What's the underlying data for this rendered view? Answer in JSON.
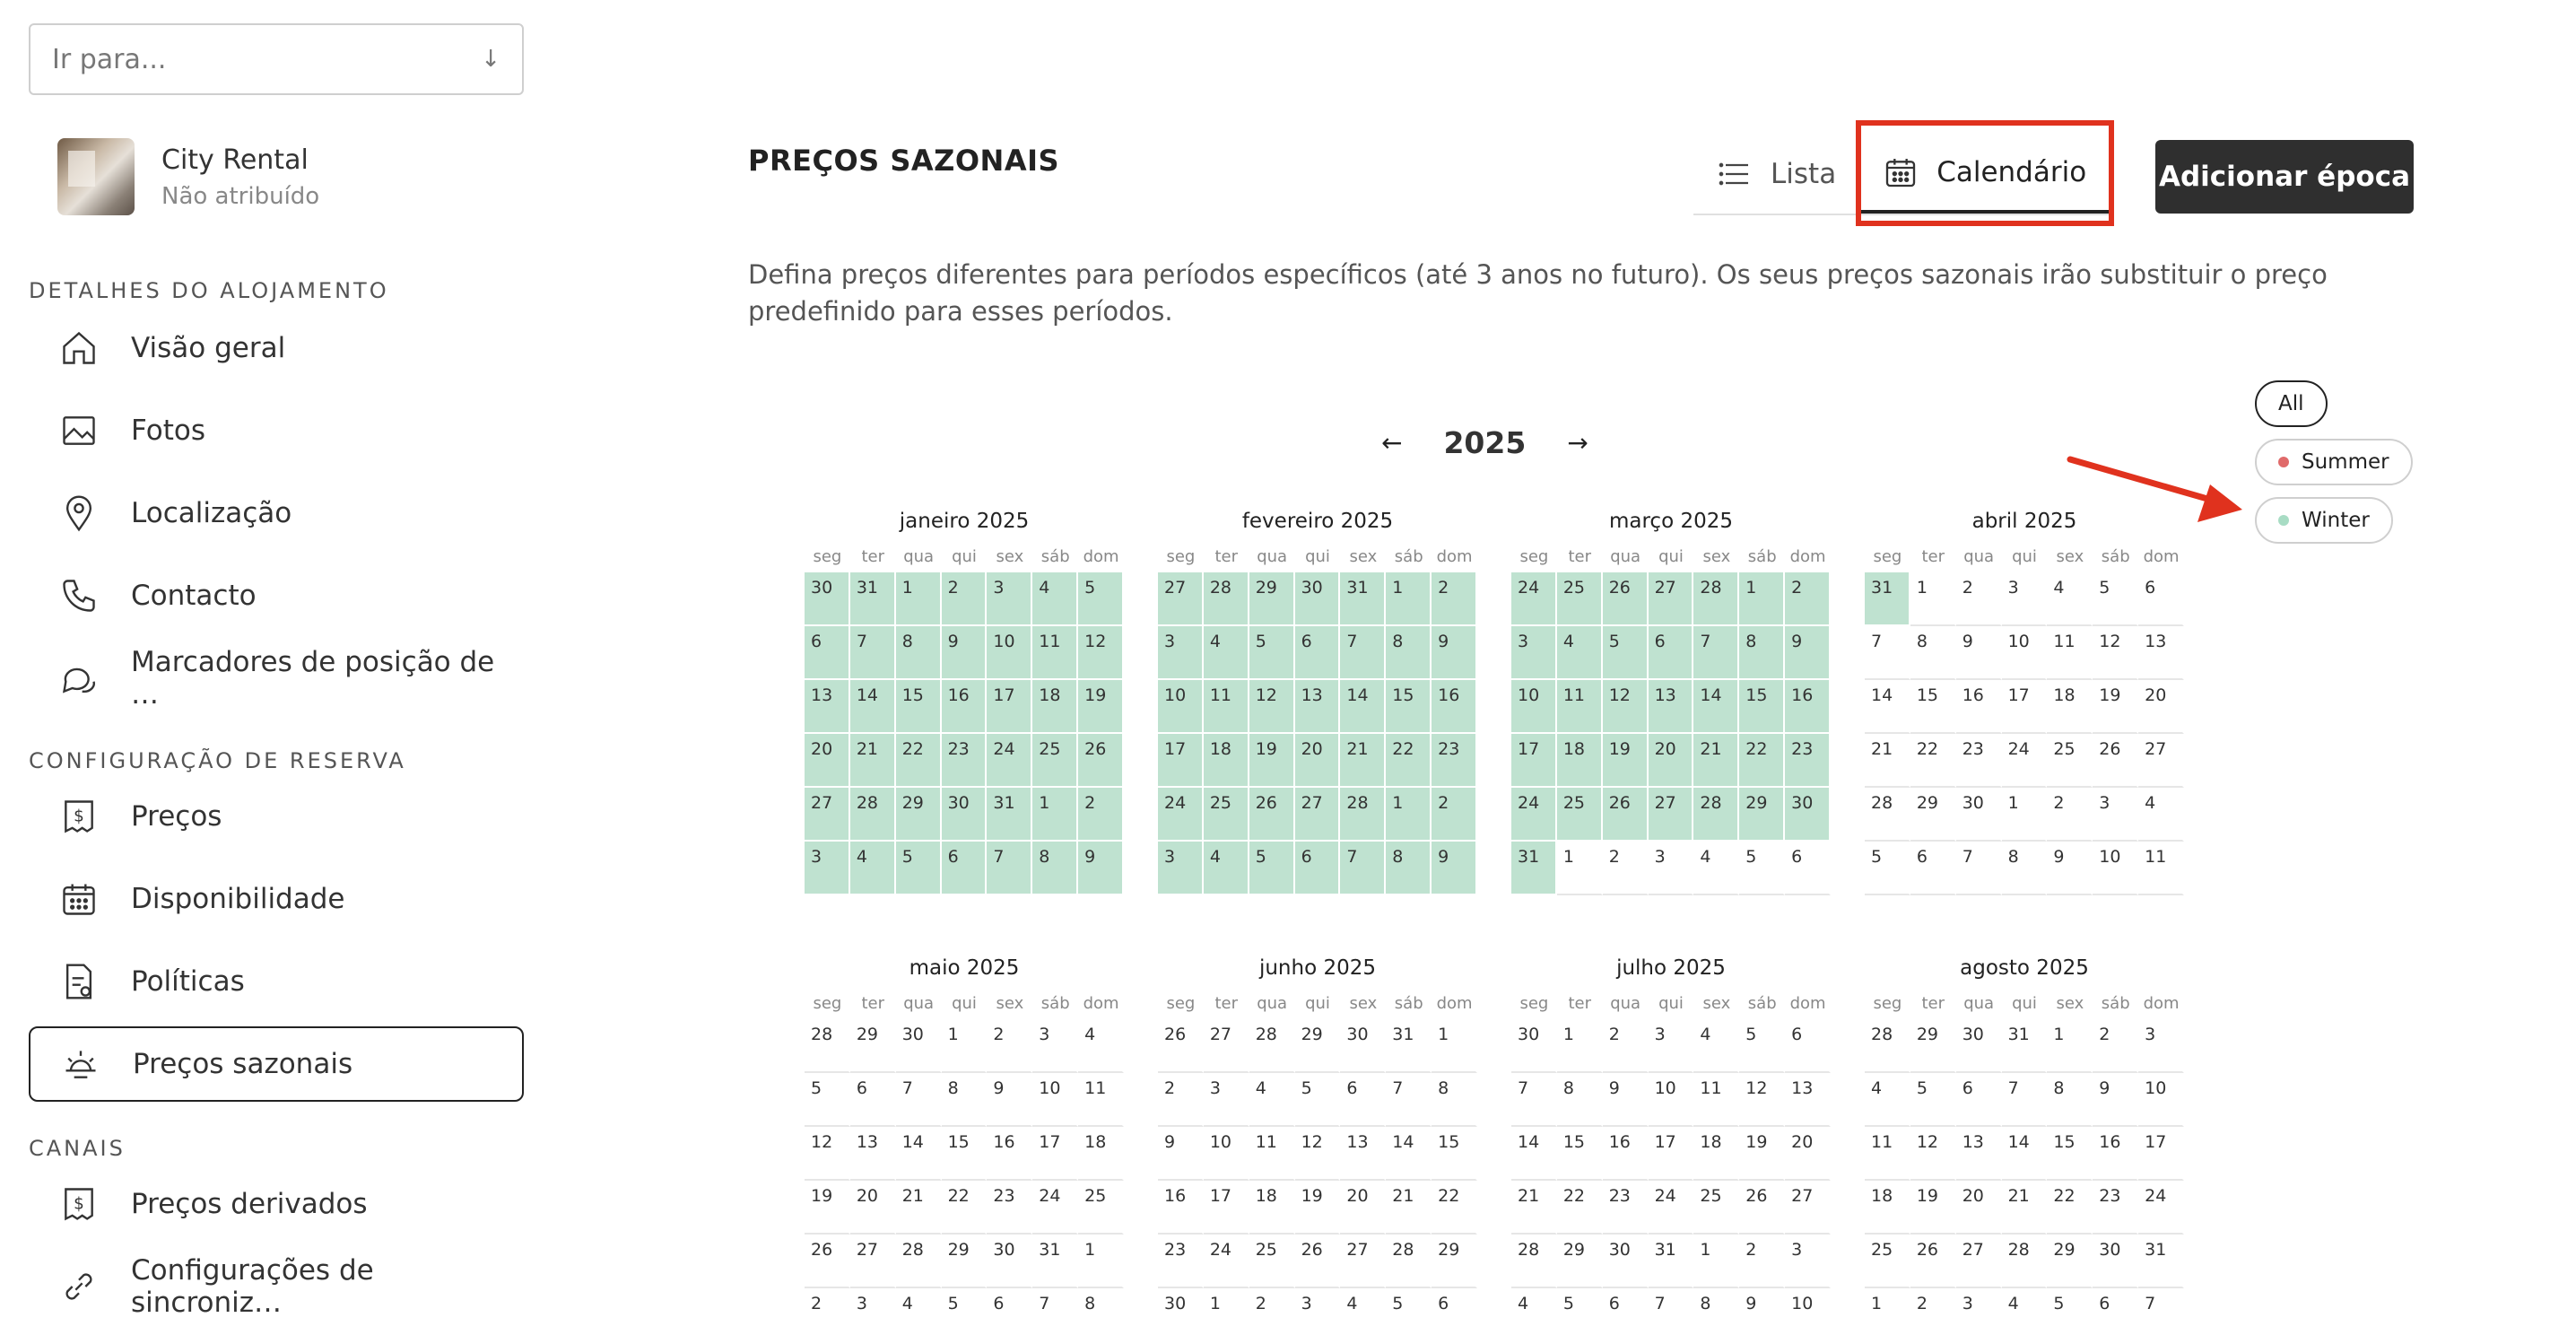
{
  "sidebar": {
    "goto_placeholder": "Ir para...",
    "listing": {
      "name": "City Rental",
      "status": "Não atribuído"
    },
    "sections": [
      {
        "title": "DETALHES DO ALOJAMENTO"
      },
      {
        "title": "CONFIGURAÇÃO DE RESERVA"
      },
      {
        "title": "CANAIS"
      }
    ],
    "items": [
      {
        "label": "Visão geral",
        "icon": "home-icon"
      },
      {
        "label": "Fotos",
        "icon": "image-icon"
      },
      {
        "label": "Localização",
        "icon": "map-pin-icon"
      },
      {
        "label": "Contacto",
        "icon": "phone-icon"
      },
      {
        "label": "Marcadores de posição de …",
        "icon": "chat-bubbles-icon"
      },
      {
        "label": "Preços",
        "icon": "price-tag-icon"
      },
      {
        "label": "Disponibilidade",
        "icon": "calendar-icon"
      },
      {
        "label": "Políticas",
        "icon": "policy-document-icon"
      },
      {
        "label": "Preços sazonais",
        "icon": "sun-icon",
        "active": true
      },
      {
        "label": "Preços derivados",
        "icon": "price-tag-icon"
      },
      {
        "label": "Configurações de sincroniz…",
        "icon": "link-icon"
      }
    ]
  },
  "main": {
    "title": "PREÇOS SAZONAIS",
    "view_tabs": [
      {
        "label": "Lista",
        "icon": "list-icon",
        "active": false
      },
      {
        "label": "Calendário",
        "icon": "calendar-icon",
        "active": true
      }
    ],
    "add_button": "Adicionar época",
    "description": "Defina preços diferentes para períodos específicos (até 3 anos no futuro). Os seus preços sazonais irão substituir o preço predefinido para esses períodos.",
    "year": "2025",
    "prev_symbol": "←",
    "next_symbol": "→",
    "filters": [
      {
        "label": "All",
        "active": true
      },
      {
        "label": "Summer",
        "color": "#e06a6a"
      },
      {
        "label": "Winter",
        "color": "#a8dcc4"
      }
    ],
    "weekdays": [
      "seg",
      "ter",
      "qua",
      "qui",
      "sex",
      "sáb",
      "dom"
    ],
    "season_colors": {
      "winter": "#bfe2d0"
    }
  },
  "months": [
    {
      "name": "janeiro 2025",
      "days": [
        30,
        31,
        1,
        2,
        3,
        4,
        5,
        6,
        7,
        8,
        9,
        10,
        11,
        12,
        13,
        14,
        15,
        16,
        17,
        18,
        19,
        20,
        21,
        22,
        23,
        24,
        25,
        26,
        27,
        28,
        29,
        30,
        31,
        1,
        2,
        3,
        4,
        5,
        6,
        7,
        8,
        9
      ],
      "winter": [
        1,
        1,
        1,
        1,
        1,
        1,
        1,
        1,
        1,
        1,
        1,
        1,
        1,
        1,
        1,
        1,
        1,
        1,
        1,
        1,
        1,
        1,
        1,
        1,
        1,
        1,
        1,
        1,
        1,
        1,
        1,
        1,
        1,
        1,
        1,
        1,
        1,
        1,
        1,
        1,
        1,
        1
      ]
    },
    {
      "name": "fevereiro 2025",
      "days": [
        27,
        28,
        29,
        30,
        31,
        1,
        2,
        3,
        4,
        5,
        6,
        7,
        8,
        9,
        10,
        11,
        12,
        13,
        14,
        15,
        16,
        17,
        18,
        19,
        20,
        21,
        22,
        23,
        24,
        25,
        26,
        27,
        28,
        1,
        2,
        3,
        4,
        5,
        6,
        7,
        8,
        9
      ],
      "winter": [
        1,
        1,
        1,
        1,
        1,
        1,
        1,
        1,
        1,
        1,
        1,
        1,
        1,
        1,
        1,
        1,
        1,
        1,
        1,
        1,
        1,
        1,
        1,
        1,
        1,
        1,
        1,
        1,
        1,
        1,
        1,
        1,
        1,
        1,
        1,
        1,
        1,
        1,
        1,
        1,
        1,
        1
      ]
    },
    {
      "name": "março 2025",
      "days": [
        24,
        25,
        26,
        27,
        28,
        1,
        2,
        3,
        4,
        5,
        6,
        7,
        8,
        9,
        10,
        11,
        12,
        13,
        14,
        15,
        16,
        17,
        18,
        19,
        20,
        21,
        22,
        23,
        24,
        25,
        26,
        27,
        28,
        29,
        30,
        31,
        1,
        2,
        3,
        4,
        5,
        6
      ],
      "winter": [
        1,
        1,
        1,
        1,
        1,
        1,
        1,
        1,
        1,
        1,
        1,
        1,
        1,
        1,
        1,
        1,
        1,
        1,
        1,
        1,
        1,
        1,
        1,
        1,
        1,
        1,
        1,
        1,
        1,
        1,
        1,
        1,
        1,
        1,
        1,
        1,
        0,
        0,
        0,
        0,
        0,
        0
      ]
    },
    {
      "name": "abril 2025",
      "days": [
        31,
        1,
        2,
        3,
        4,
        5,
        6,
        7,
        8,
        9,
        10,
        11,
        12,
        13,
        14,
        15,
        16,
        17,
        18,
        19,
        20,
        21,
        22,
        23,
        24,
        25,
        26,
        27,
        28,
        29,
        30,
        1,
        2,
        3,
        4,
        5,
        6,
        7,
        8,
        9,
        10,
        11
      ],
      "winter": [
        1,
        0,
        0,
        0,
        0,
        0,
        0,
        0,
        0,
        0,
        0,
        0,
        0,
        0,
        0,
        0,
        0,
        0,
        0,
        0,
        0,
        0,
        0,
        0,
        0,
        0,
        0,
        0,
        0,
        0,
        0,
        0,
        0,
        0,
        0,
        0,
        0,
        0,
        0,
        0,
        0,
        0
      ]
    },
    {
      "name": "maio 2025",
      "days": [
        28,
        29,
        30,
        1,
        2,
        3,
        4,
        5,
        6,
        7,
        8,
        9,
        10,
        11,
        12,
        13,
        14,
        15,
        16,
        17,
        18,
        19,
        20,
        21,
        22,
        23,
        24,
        25,
        26,
        27,
        28,
        29,
        30,
        31,
        1,
        2,
        3,
        4,
        5,
        6,
        7,
        8
      ],
      "winter": []
    },
    {
      "name": "junho 2025",
      "days": [
        26,
        27,
        28,
        29,
        30,
        31,
        1,
        2,
        3,
        4,
        5,
        6,
        7,
        8,
        9,
        10,
        11,
        12,
        13,
        14,
        15,
        16,
        17,
        18,
        19,
        20,
        21,
        22,
        23,
        24,
        25,
        26,
        27,
        28,
        29,
        30,
        1,
        2,
        3,
        4,
        5,
        6
      ],
      "winter": []
    },
    {
      "name": "julho 2025",
      "days": [
        30,
        1,
        2,
        3,
        4,
        5,
        6,
        7,
        8,
        9,
        10,
        11,
        12,
        13,
        14,
        15,
        16,
        17,
        18,
        19,
        20,
        21,
        22,
        23,
        24,
        25,
        26,
        27,
        28,
        29,
        30,
        31,
        1,
        2,
        3,
        4,
        5,
        6,
        7,
        8,
        9,
        10
      ],
      "winter": []
    },
    {
      "name": "agosto 2025",
      "days": [
        28,
        29,
        30,
        31,
        1,
        2,
        3,
        4,
        5,
        6,
        7,
        8,
        9,
        10,
        11,
        12,
        13,
        14,
        15,
        16,
        17,
        18,
        19,
        20,
        21,
        22,
        23,
        24,
        25,
        26,
        27,
        28,
        29,
        30,
        31,
        1,
        2,
        3,
        4,
        5,
        6,
        7
      ],
      "winter": []
    }
  ]
}
